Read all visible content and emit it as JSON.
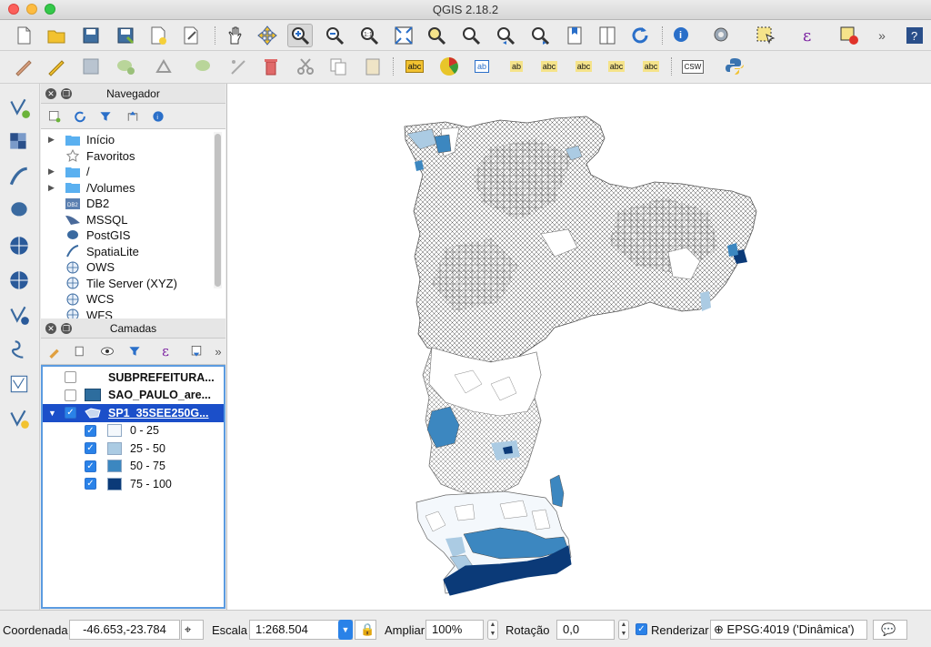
{
  "window": {
    "title": "QGIS 2.18.2"
  },
  "toolbar1": {
    "icons": [
      "new-project-icon",
      "open-project-icon",
      "save-project-icon",
      "save-as-icon",
      "new-print-composer-icon",
      "composer-manager-icon",
      "pan-icon",
      "pan-to-selection-icon",
      "touch-zoom-icon",
      "zoom-in-icon",
      "zoom-out-icon",
      "zoom-actual-icon",
      "zoom-full-icon",
      "zoom-to-selection-icon",
      "zoom-to-layer-icon",
      "zoom-last-icon",
      "zoom-next-icon",
      "new-bookmark-icon",
      "show-bookmarks-icon",
      "refresh-icon",
      "identify-icon",
      "run-action-icon",
      "select-features-icon",
      "select-expression-icon",
      "deselect-icon",
      "more-icon",
      "help-icon"
    ]
  },
  "toolbar2": {
    "icons": [
      "current-edits-icon",
      "toggle-editing-icon",
      "save-edits-icon",
      "add-feature-icon",
      "move-feature-icon",
      "node-tool-icon",
      "delete-selected-icon",
      "cut-features-icon",
      "copy-features-icon",
      "paste-features-icon"
    ],
    "labels": {
      "abc1": "abc",
      "abc2": "ab",
      "abc3": "ab",
      "abc4": "abc",
      "abc5": "abc",
      "abc6": "abc",
      "abc7": "abc",
      "csw": "CSW"
    }
  },
  "navigator": {
    "title": "Navegador",
    "items": [
      {
        "label": "Início",
        "expandable": true,
        "icon": "folder-icon"
      },
      {
        "label": "Favoritos",
        "expandable": false,
        "icon": "star-icon"
      },
      {
        "label": "/",
        "expandable": true,
        "icon": "folder-icon"
      },
      {
        "label": "/Volumes",
        "expandable": true,
        "icon": "folder-icon"
      },
      {
        "label": "DB2",
        "expandable": false,
        "icon": "db2-icon"
      },
      {
        "label": "MSSQL",
        "expandable": false,
        "icon": "mssql-icon"
      },
      {
        "label": "PostGIS",
        "expandable": false,
        "icon": "postgis-icon"
      },
      {
        "label": "SpatiaLite",
        "expandable": false,
        "icon": "spatialite-icon"
      },
      {
        "label": "OWS",
        "expandable": false,
        "icon": "globe-icon"
      },
      {
        "label": "Tile Server (XYZ)",
        "expandable": false,
        "icon": "globe-icon"
      },
      {
        "label": "WCS",
        "expandable": false,
        "icon": "globe-icon"
      },
      {
        "label": "WFS",
        "expandable": false,
        "icon": "globe-icon"
      }
    ]
  },
  "layers": {
    "title": "Camadas",
    "items": [
      {
        "label": "SUBPREFEITURA...",
        "checked": false,
        "swatch": ""
      },
      {
        "label": "SAO_PAULO_are...",
        "checked": false,
        "swatch": "#2d6d9e"
      },
      {
        "label": "SP1_35SEE250G...",
        "checked": true,
        "swatch": "",
        "selected": true
      }
    ],
    "legend": [
      {
        "label": "0 - 25",
        "color": "#f4f8fc",
        "checked": true
      },
      {
        "label": "25 - 50",
        "color": "#abcbe3",
        "checked": true
      },
      {
        "label": "50 - 75",
        "color": "#3c87c0",
        "checked": true
      },
      {
        "label": "75 - 100",
        "color": "#0b3a78",
        "checked": true
      }
    ]
  },
  "status": {
    "coord_label": "Coordenada",
    "coord_value": "-46.653,-23.784",
    "scale_label": "Escala",
    "scale_value": "1:268.504",
    "magnify_label": "Ampliar",
    "magnify_value": "100%",
    "rotation_label": "Rotação",
    "rotation_value": "0,0",
    "render_label": "Renderizar",
    "render_checked": true,
    "crs_label": "EPSG:4019 ('Dinâmica')"
  },
  "colors": {
    "accent": "#2a82e8",
    "selection": "#1b4fc9"
  }
}
